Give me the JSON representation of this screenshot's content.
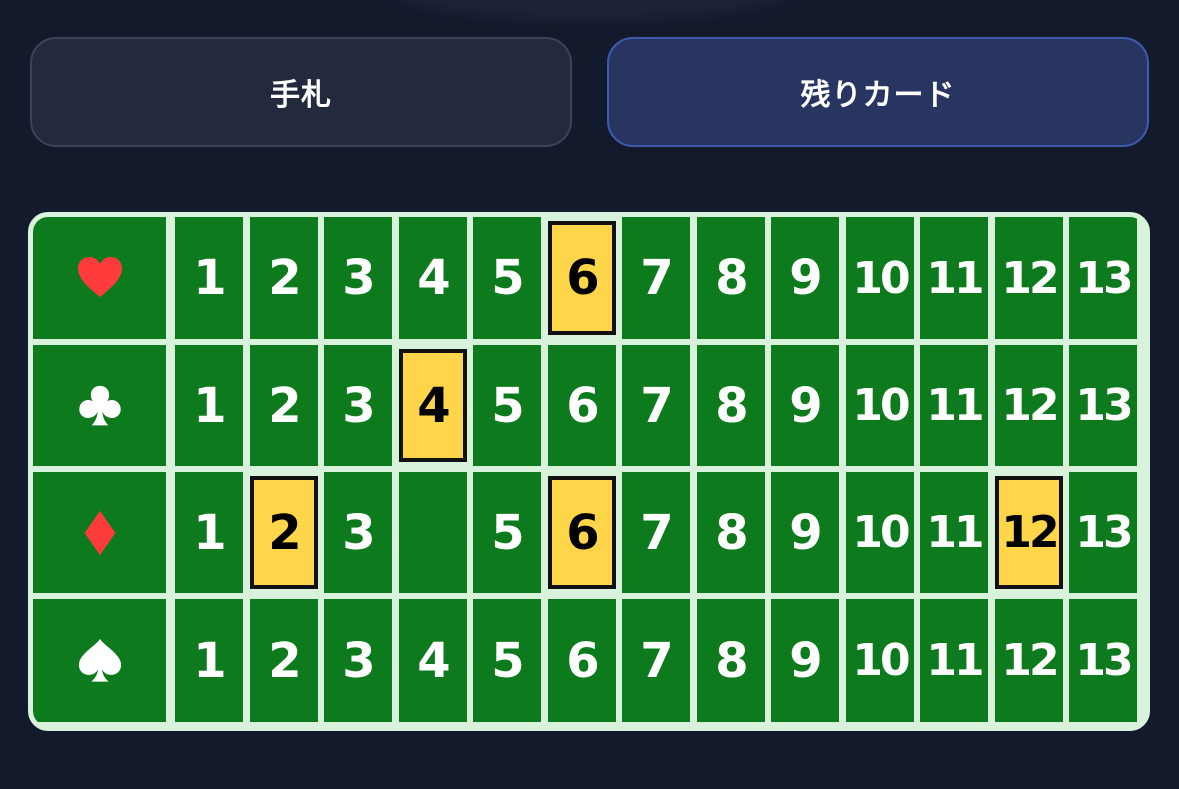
{
  "tabs": [
    {
      "label": "手札",
      "active": false
    },
    {
      "label": "残りカード",
      "active": true
    }
  ],
  "colors": {
    "background": "#131a2c",
    "felt": "#0e7a1e",
    "grid_line": "#d9f2dc",
    "highlight": "#ffd54a",
    "red_suit": "#ff3b3b",
    "black_suit": "#ffffff"
  },
  "board": {
    "rows": [
      {
        "suit": "heart",
        "icon": "heart-icon",
        "cards": [
          "1",
          "2",
          "3",
          "4",
          "5",
          "6",
          "7",
          "8",
          "9",
          "10",
          "11",
          "12",
          "13"
        ],
        "highlighted": [
          "6"
        ]
      },
      {
        "suit": "club",
        "icon": "club-icon",
        "cards": [
          "1",
          "2",
          "3",
          "4",
          "5",
          "6",
          "7",
          "8",
          "9",
          "10",
          "11",
          "12",
          "13"
        ],
        "highlighted": [
          "4"
        ]
      },
      {
        "suit": "diamond",
        "icon": "diamond-icon",
        "cards": [
          "1",
          "2",
          "3",
          "",
          "5",
          "6",
          "7",
          "8",
          "9",
          "10",
          "11",
          "12",
          "13"
        ],
        "highlighted": [
          "2",
          "6",
          "12"
        ]
      },
      {
        "suit": "spade",
        "icon": "spade-icon",
        "cards": [
          "1",
          "2",
          "3",
          "4",
          "5",
          "6",
          "7",
          "8",
          "9",
          "10",
          "11",
          "12",
          "13"
        ],
        "highlighted": []
      }
    ]
  }
}
